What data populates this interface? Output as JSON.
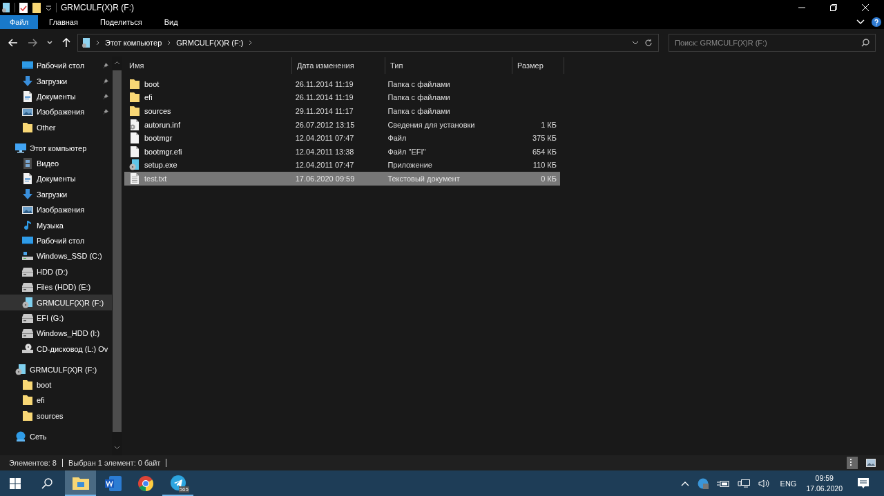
{
  "window": {
    "title": "GRMCULF(X)R (F:)"
  },
  "ribbon_tabs": [
    {
      "label": "Файл",
      "selected": true
    },
    {
      "label": "Главная",
      "selected": false
    },
    {
      "label": "Поделиться",
      "selected": false
    },
    {
      "label": "Вид",
      "selected": false
    }
  ],
  "address": {
    "path": [
      "Этот компьютер",
      "GRMCULF(X)R (F:)"
    ]
  },
  "search": {
    "placeholder": "Поиск: GRMCULF(X)R (F:)"
  },
  "sidebar": {
    "quick_access": [
      {
        "label": "Рабочий стол",
        "kind": "desktop",
        "pinned": true
      },
      {
        "label": "Загрузки",
        "kind": "download",
        "pinned": true
      },
      {
        "label": "Документы",
        "kind": "document",
        "pinned": true
      },
      {
        "label": "Изображения",
        "kind": "image",
        "pinned": true
      },
      {
        "label": "Other",
        "kind": "folder",
        "pinned": false
      }
    ],
    "tree": [
      {
        "label": "Этот компьютер",
        "kind": "computer",
        "selected": false,
        "children": [
          {
            "label": "Видео",
            "kind": "video",
            "selected": false
          },
          {
            "label": "Документы",
            "kind": "document",
            "selected": false
          },
          {
            "label": "Загрузки",
            "kind": "download",
            "selected": false
          },
          {
            "label": "Изображения",
            "kind": "image",
            "selected": false
          },
          {
            "label": "Музыка",
            "kind": "music",
            "selected": false
          },
          {
            "label": "Рабочий стол",
            "kind": "desktop",
            "selected": false
          },
          {
            "label": "Windows_SSD (C:)",
            "kind": "system-drive",
            "selected": false
          },
          {
            "label": "HDD (D:)",
            "kind": "drive",
            "selected": false
          },
          {
            "label": "Files (HDD) (E:)",
            "kind": "drive",
            "selected": false
          },
          {
            "label": "GRMCULF(X)R (F:)",
            "kind": "setup-drive",
            "selected": true
          },
          {
            "label": "EFI (G:)",
            "kind": "drive",
            "selected": false
          },
          {
            "label": "Windows_HDD (I:)",
            "kind": "drive",
            "selected": false
          },
          {
            "label": "CD-дисковод (L:) Ov",
            "kind": "cd-drive",
            "selected": false
          }
        ]
      },
      {
        "label": "GRMCULF(X)R (F:)",
        "kind": "setup-drive",
        "selected": false,
        "children": [
          {
            "label": "boot",
            "kind": "folder",
            "selected": false
          },
          {
            "label": "efi",
            "kind": "folder",
            "selected": false
          },
          {
            "label": "sources",
            "kind": "folder",
            "selected": false
          }
        ]
      },
      {
        "label": "Сеть",
        "kind": "network",
        "selected": false
      }
    ]
  },
  "table": {
    "columns": [
      "Имя",
      "Дата изменения",
      "Тип",
      "Размер"
    ],
    "rows": [
      {
        "kind": "folder",
        "name": "boot",
        "date": "26.11.2014 11:19",
        "type": "Папка с файлами",
        "size": "",
        "selected": false
      },
      {
        "kind": "folder",
        "name": "efi",
        "date": "26.11.2014 11:19",
        "type": "Папка с файлами",
        "size": "",
        "selected": false
      },
      {
        "kind": "folder",
        "name": "sources",
        "date": "29.11.2014 11:17",
        "type": "Папка с файлами",
        "size": "",
        "selected": false
      },
      {
        "kind": "settings-file",
        "name": "autorun.inf",
        "date": "26.07.2012 13:15",
        "type": "Сведения для установки",
        "size": "1 КБ",
        "selected": false
      },
      {
        "kind": "file",
        "name": "bootmgr",
        "date": "12.04.2011 07:47",
        "type": "Файл",
        "size": "375 КБ",
        "selected": false
      },
      {
        "kind": "file",
        "name": "bootmgr.efi",
        "date": "12.04.2011 13:38",
        "type": "Файл \"EFI\"",
        "size": "654 КБ",
        "selected": false
      },
      {
        "kind": "setup",
        "name": "setup.exe",
        "date": "12.04.2011 07:47",
        "type": "Приложение",
        "size": "110 КБ",
        "selected": false
      },
      {
        "kind": "text",
        "name": "test.txt",
        "date": "17.06.2020 09:59",
        "type": "Текстовый документ",
        "size": "0 КБ",
        "selected": true
      }
    ]
  },
  "status_bar": {
    "items": [
      "Элементов: 8",
      "Выбран 1 элемент: 0 байт"
    ]
  },
  "taskbar": {
    "apps": [
      {
        "kind": "explorer",
        "active": true,
        "running": true
      },
      {
        "kind": "word",
        "active": false,
        "running": false
      },
      {
        "kind": "chrome",
        "active": false,
        "running": false
      },
      {
        "kind": "telegram",
        "active": false,
        "running": true,
        "badge": "565"
      }
    ],
    "language": "ENG",
    "time": "09:59",
    "date": "17.06.2020"
  }
}
